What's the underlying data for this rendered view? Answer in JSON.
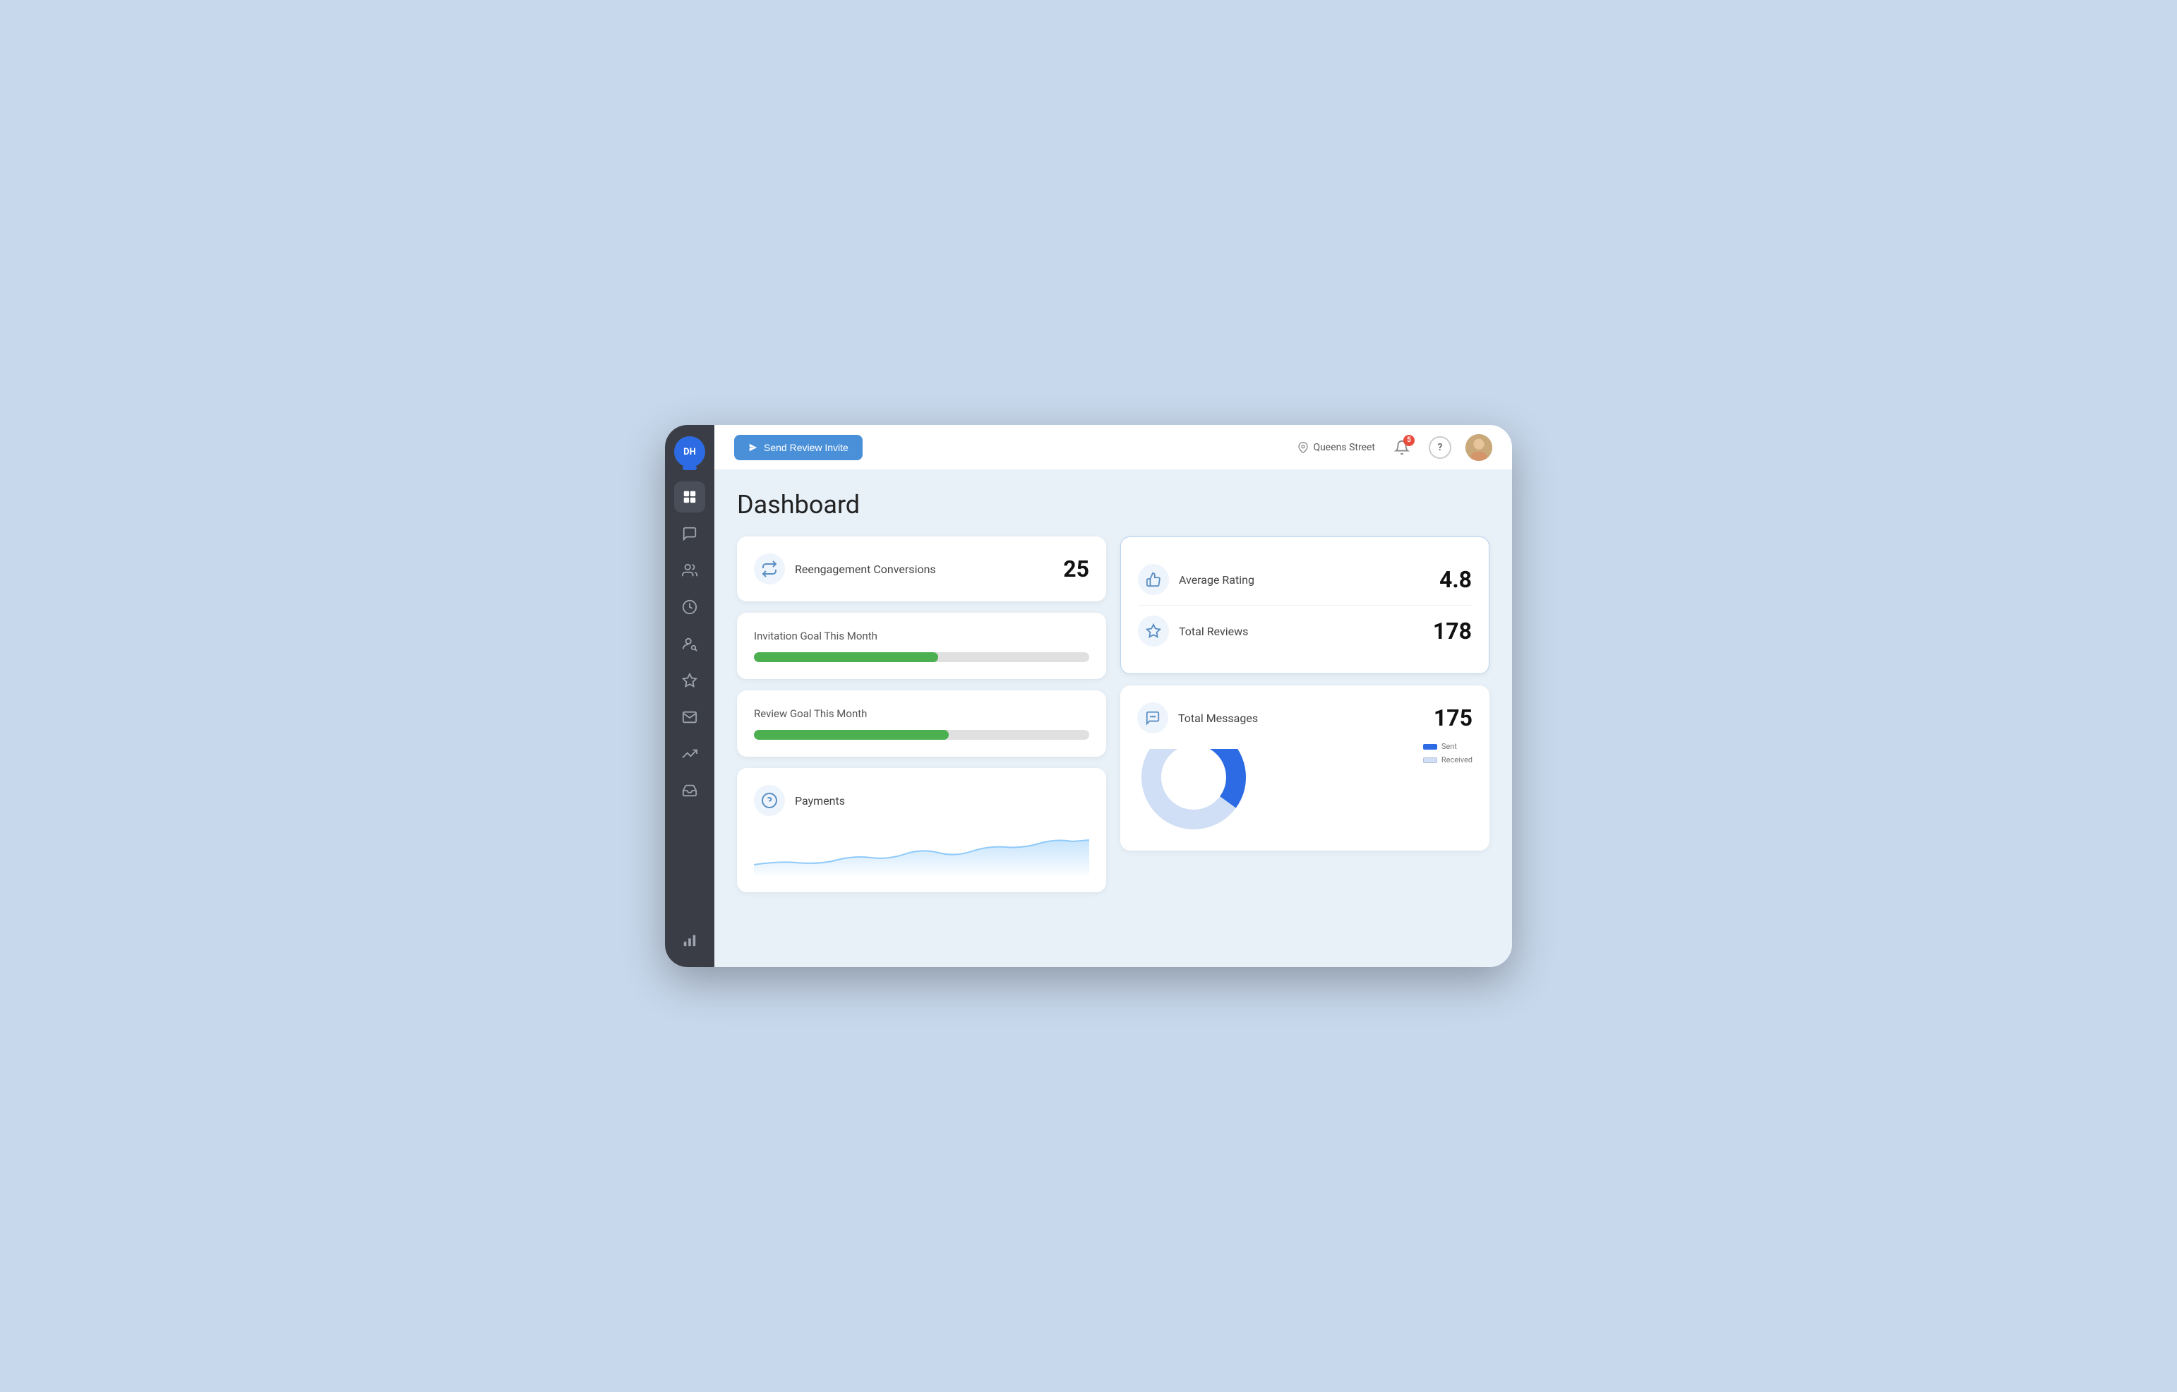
{
  "app": {
    "logo_text": "DH",
    "page_title": "Dashboard"
  },
  "header": {
    "send_invite_label": "Send Review Invite",
    "location": "Queens Street",
    "notification_count": "5",
    "help_label": "?"
  },
  "sidebar": {
    "items": [
      {
        "id": "dashboard",
        "label": "Dashboard",
        "active": true
      },
      {
        "id": "messages",
        "label": "Messages",
        "active": false
      },
      {
        "id": "contacts",
        "label": "Contacts",
        "active": false
      },
      {
        "id": "history",
        "label": "History",
        "active": false
      },
      {
        "id": "users",
        "label": "Users",
        "active": false
      },
      {
        "id": "reviews",
        "label": "Reviews",
        "active": false
      },
      {
        "id": "email",
        "label": "Email",
        "active": false
      },
      {
        "id": "analytics",
        "label": "Analytics",
        "active": false
      },
      {
        "id": "inbox",
        "label": "Inbox",
        "active": false
      },
      {
        "id": "reports",
        "label": "Reports",
        "active": false
      }
    ]
  },
  "cards": {
    "reengagement": {
      "label": "Reengagement Conversions",
      "value": "25"
    },
    "invitation_goal": {
      "label": "Invitation Goal This Month",
      "progress": 55
    },
    "review_goal": {
      "label": "Review Goal This Month",
      "progress": 58
    },
    "payments": {
      "label": "Payments"
    },
    "average_rating": {
      "label": "Average Rating",
      "value": "4.8"
    },
    "total_reviews": {
      "label": "Total Reviews",
      "value": "178"
    },
    "total_messages": {
      "label": "Total Messages",
      "value": "175",
      "sent_label": "Sent",
      "received_label": "Received"
    }
  },
  "colors": {
    "accent_blue": "#4a90d9",
    "green_progress": "#4caf50",
    "donut_blue": "#2d6be4",
    "donut_light": "#d0dff5"
  }
}
